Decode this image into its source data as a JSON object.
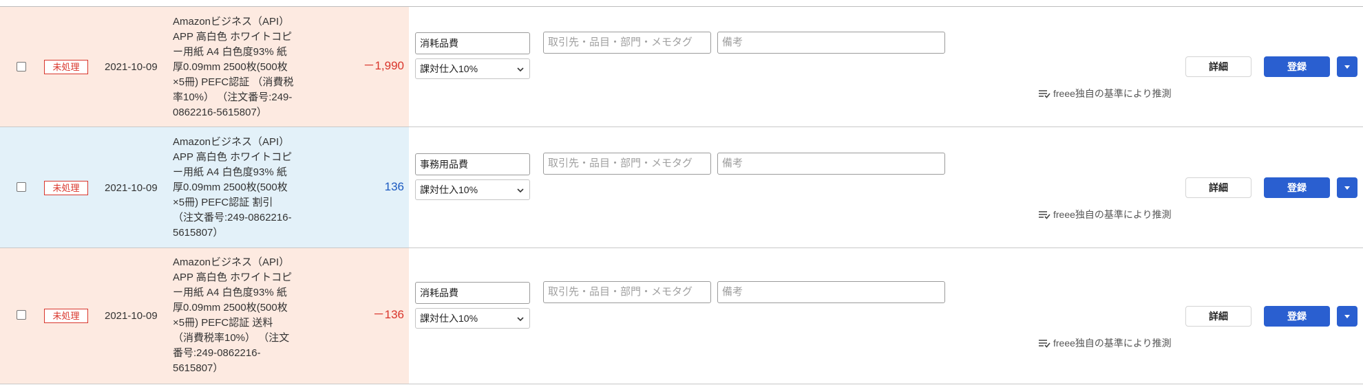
{
  "rows": [
    {
      "kind": "expense",
      "status": "未処理",
      "date": "2021-10-09",
      "description": "Amazonビジネス（API）\nAPP 高白色 ホワイトコピ\nー用紙 A4 白色度93% 紙\n厚0.09mm 2500枚(500枚\n×5冊) PEFC認証 （消費税\n率10%） （注文番号:249-\n0862216-5615807）",
      "amount": "－1,990",
      "account": "消耗品費",
      "tax": "課対仕入10%",
      "partner_placeholder": "取引先・品目・部門・メモタグ",
      "note_placeholder": "備考",
      "guess": "freee独自の基準により推測",
      "detail_label": "詳細",
      "register_label": "登録"
    },
    {
      "kind": "income",
      "status": "未処理",
      "date": "2021-10-09",
      "description": "Amazonビジネス（API）\nAPP 高白色 ホワイトコピ\nー用紙 A4 白色度93% 紙\n厚0.09mm 2500枚(500枚\n×5冊) PEFC認証 割引\n（注文番号:249-0862216-\n5615807）",
      "amount": "136",
      "account": "事務用品費",
      "tax": "課対仕入10%",
      "partner_placeholder": "取引先・品目・部門・メモタグ",
      "note_placeholder": "備考",
      "guess": "freee独自の基準により推測",
      "detail_label": "詳細",
      "register_label": "登録"
    },
    {
      "kind": "expense",
      "status": "未処理",
      "date": "2021-10-09",
      "description": "Amazonビジネス（API）\nAPP 高白色 ホワイトコピ\nー用紙 A4 白色度93% 紙\n厚0.09mm 2500枚(500枚\n×5冊) PEFC認証 送料\n（消費税率10%） （注文\n番号:249-0862216-\n5615807）",
      "amount": "－136",
      "account": "消耗品費",
      "tax": "課対仕入10%",
      "partner_placeholder": "取引先・品目・部門・メモタグ",
      "note_placeholder": "備考",
      "guess": "freee独自の基準により推測",
      "detail_label": "詳細",
      "register_label": "登録"
    }
  ],
  "colors": {
    "expense_bg": "#fdeae1",
    "income_bg": "#e3f1f9",
    "negative_amount": "#d9352b",
    "positive_amount": "#1b59c0",
    "primary_button": "#2a5fd0",
    "status_badge": "#d9352b"
  },
  "icons": {
    "guess": "lines-check-icon",
    "select": "chevron-down-icon",
    "register_menu": "caret-down-icon"
  }
}
